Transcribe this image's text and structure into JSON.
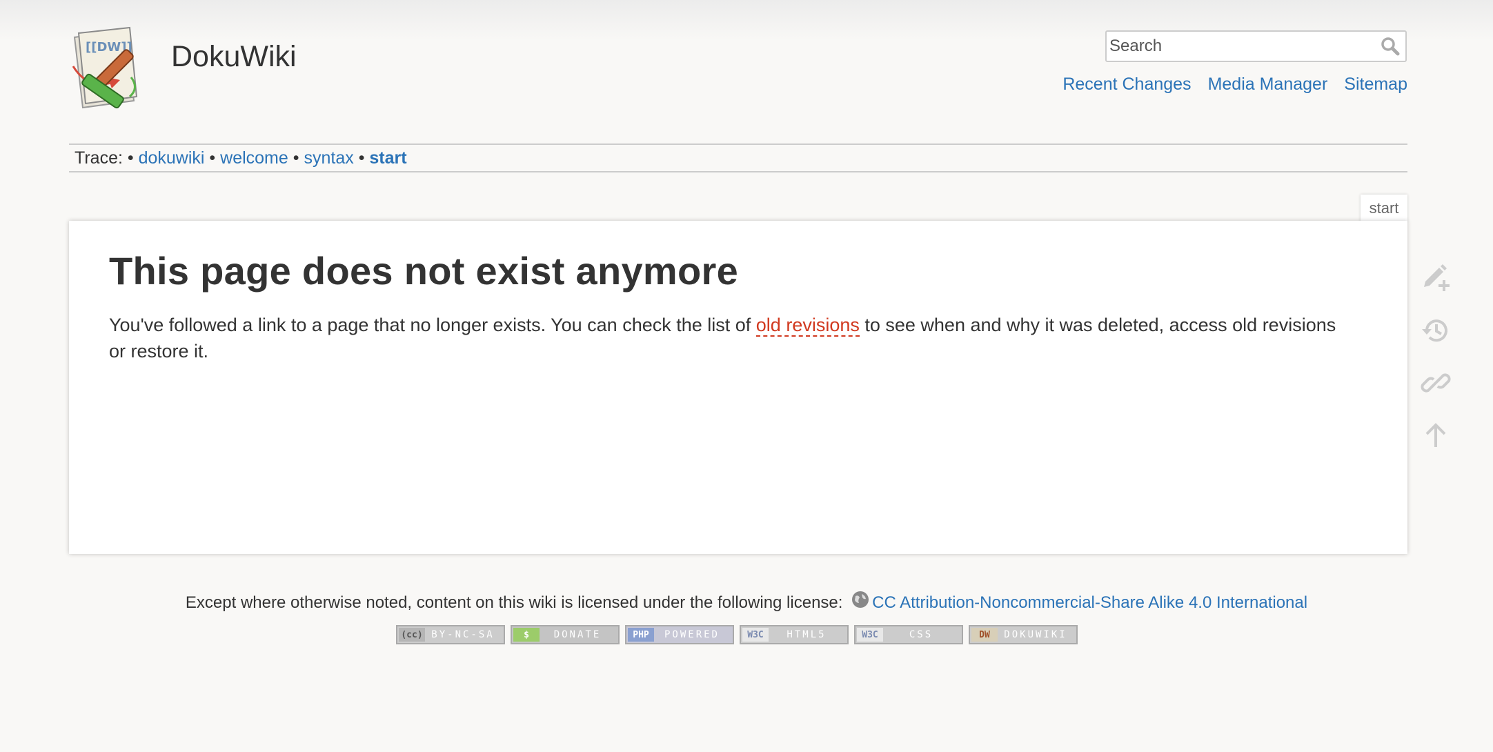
{
  "site": {
    "title": "DokuWiki"
  },
  "search": {
    "placeholder": "Search"
  },
  "nav": {
    "recent_changes": "Recent Changes",
    "media_manager": "Media Manager",
    "sitemap": "Sitemap"
  },
  "trace": {
    "label": "Trace:",
    "separator": "•",
    "items": [
      "dokuwiki",
      "welcome",
      "syntax",
      "start"
    ]
  },
  "page": {
    "id": "start",
    "heading": "This page does not exist anymore",
    "text_before": "You've followed a link to a page that no longer exists. You can check the list of ",
    "link_text": "old revisions",
    "text_after": " to see when and why it was deleted, access old revisions or restore it."
  },
  "footer": {
    "license_text": "Except where otherwise noted, content on this wiki is licensed under the following license:",
    "license_link": "CC Attribution-Noncommercial-Share Alike 4.0 International",
    "badges": [
      {
        "chip": "(cc)",
        "label": "BY-NC-SA"
      },
      {
        "chip": "$",
        "label": "DONATE"
      },
      {
        "chip": "PHP",
        "label": "POWERED"
      },
      {
        "chip": "W3C",
        "label": "HTML5"
      },
      {
        "chip": "W3C",
        "label": "CSS"
      },
      {
        "chip": "DW",
        "label": "DOKUWIKI"
      }
    ]
  },
  "icons": {
    "logo": "dokuwiki-logo",
    "search": "magnifier-icon",
    "pagetools": [
      "edit-icon",
      "history-icon",
      "backlinks-icon",
      "back-to-top-icon"
    ],
    "license": "globe-icon"
  },
  "colors": {
    "link": "#2b73b7",
    "missing_link": "#d1391f",
    "background": "#f9f8f6"
  }
}
